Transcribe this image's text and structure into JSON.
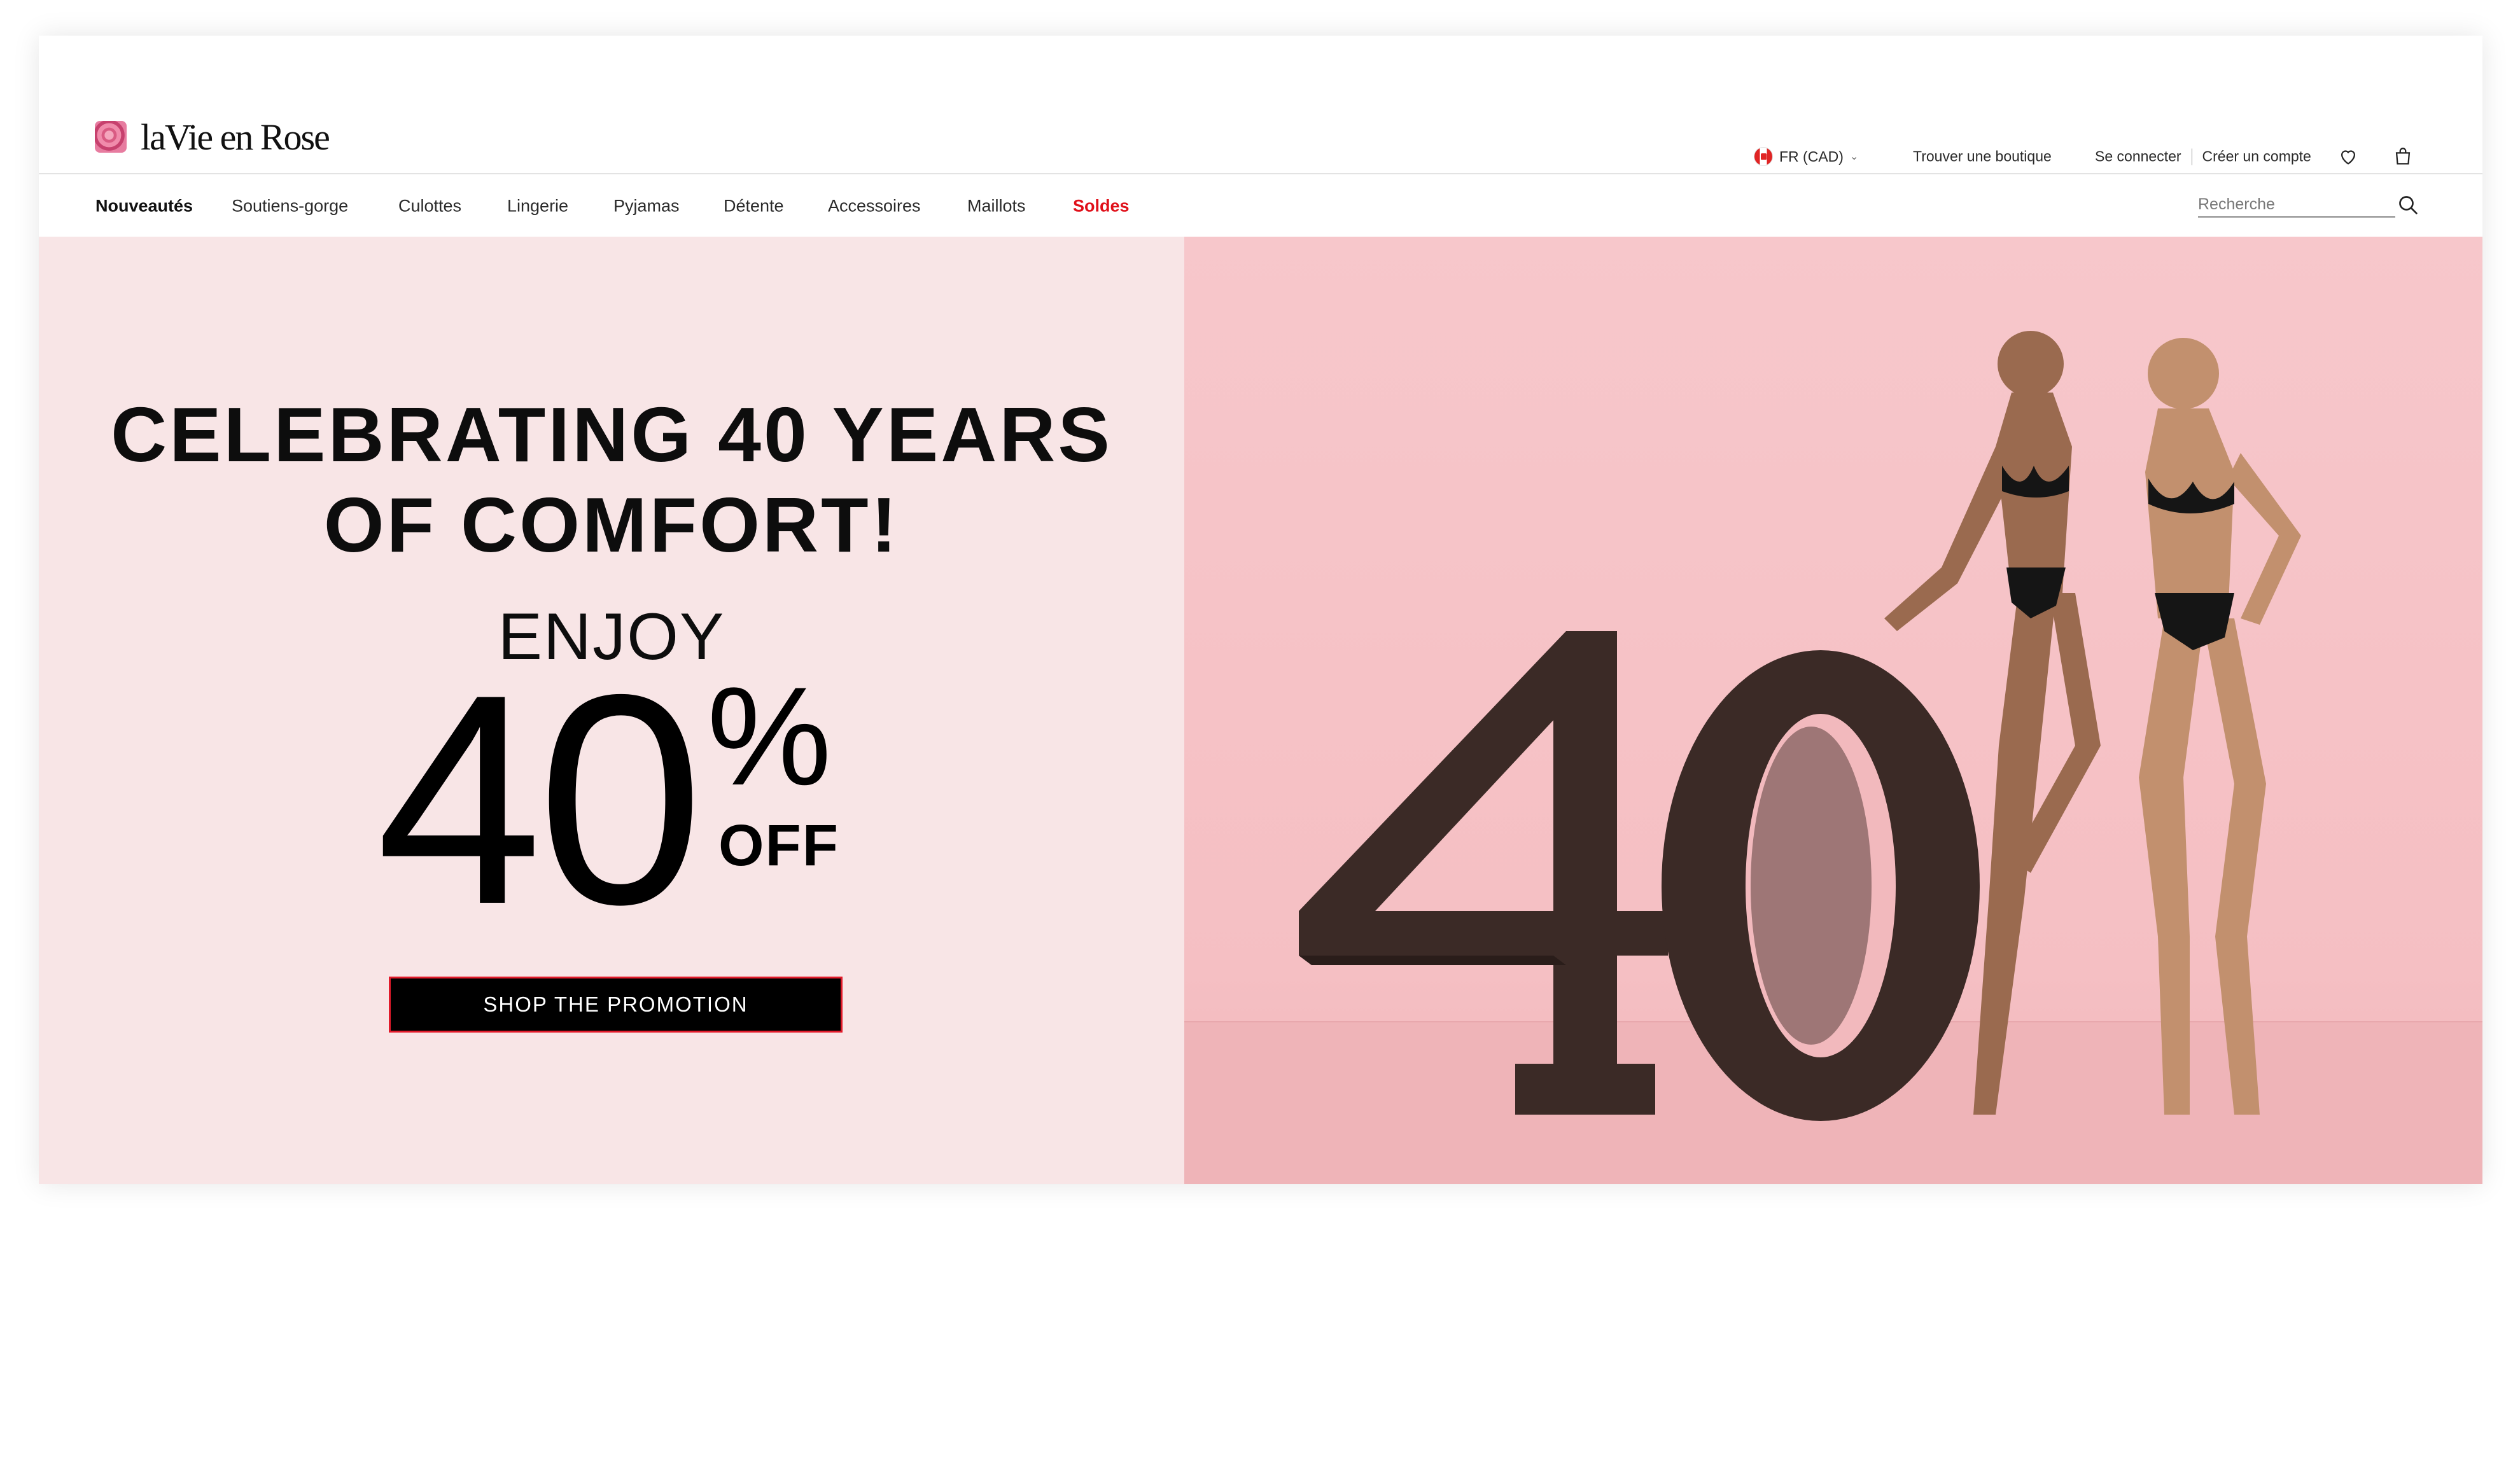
{
  "brand": {
    "name": "laVie en Rose"
  },
  "header": {
    "locale": "FR (CAD)",
    "store_finder": "Trouver une boutique",
    "sign_in": "Se connecter",
    "create_account": "Créer un compte"
  },
  "nav": {
    "items": [
      {
        "label": "Nouveautés"
      },
      {
        "label": "Soutiens-gorge"
      },
      {
        "label": "Culottes"
      },
      {
        "label": "Lingerie"
      },
      {
        "label": "Pyjamas"
      },
      {
        "label": "Détente"
      },
      {
        "label": "Accessoires"
      },
      {
        "label": "Maillots"
      },
      {
        "label": "Soldes"
      }
    ],
    "search_placeholder": "Recherche"
  },
  "hero": {
    "headline_line1": "CELEBRATING 40 YEARS",
    "headline_line2": "OF COMFORT!",
    "enjoy": "ENJOY",
    "discount_number": "40",
    "percent_sign": "%",
    "off": "OFF",
    "cta_label": "SHOP THE PROMOTION"
  },
  "colors": {
    "accent_red": "#e0101a",
    "hero_left_bg": "#f8e5e6",
    "hero_right_bg": "#f7c7cb",
    "sculpture": "#3a2a26"
  },
  "icons": [
    "flag-canada-icon",
    "chevron-down-icon",
    "heart-icon",
    "shopping-bag-icon",
    "search-icon"
  ]
}
